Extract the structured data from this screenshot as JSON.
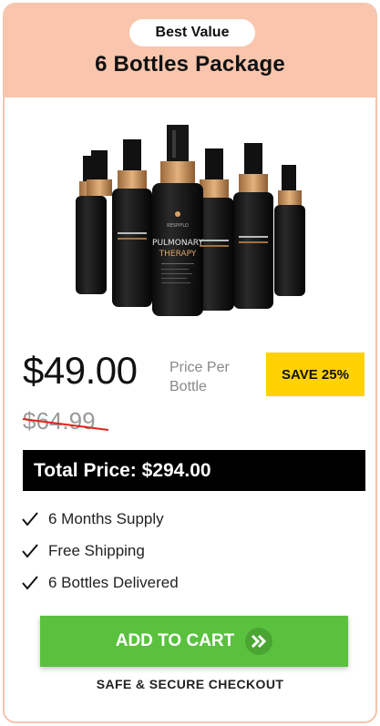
{
  "header": {
    "badge": "Best Value",
    "title": "6 Bottles Package"
  },
  "product": {
    "image": "six-bottles-image",
    "brand": "RESPIFLO",
    "label_line1": "PULMONARY",
    "label_line2": "THERAPY"
  },
  "pricing": {
    "price": "$49.00",
    "per_label": "Price Per Bottle",
    "save_badge": "SAVE 25%",
    "old_price": "$64.99",
    "total": "Total Price: $294.00"
  },
  "features": [
    {
      "icon": "checkmark-icon",
      "label": "6 Months Supply"
    },
    {
      "icon": "checkmark-icon",
      "label": "Free Shipping"
    },
    {
      "icon": "checkmark-icon",
      "label": "6 Bottles Delivered"
    }
  ],
  "cart": {
    "label": "ADD TO CART",
    "icon": "double-chevron-right-icon"
  },
  "footer": {
    "secure": "SAFE & SECURE CHECKOUT"
  },
  "colors": {
    "header_bg": "#f9c5ad",
    "save_badge": "#ffd200",
    "cart_button": "#5ac13f",
    "strike": "#e0241b"
  }
}
